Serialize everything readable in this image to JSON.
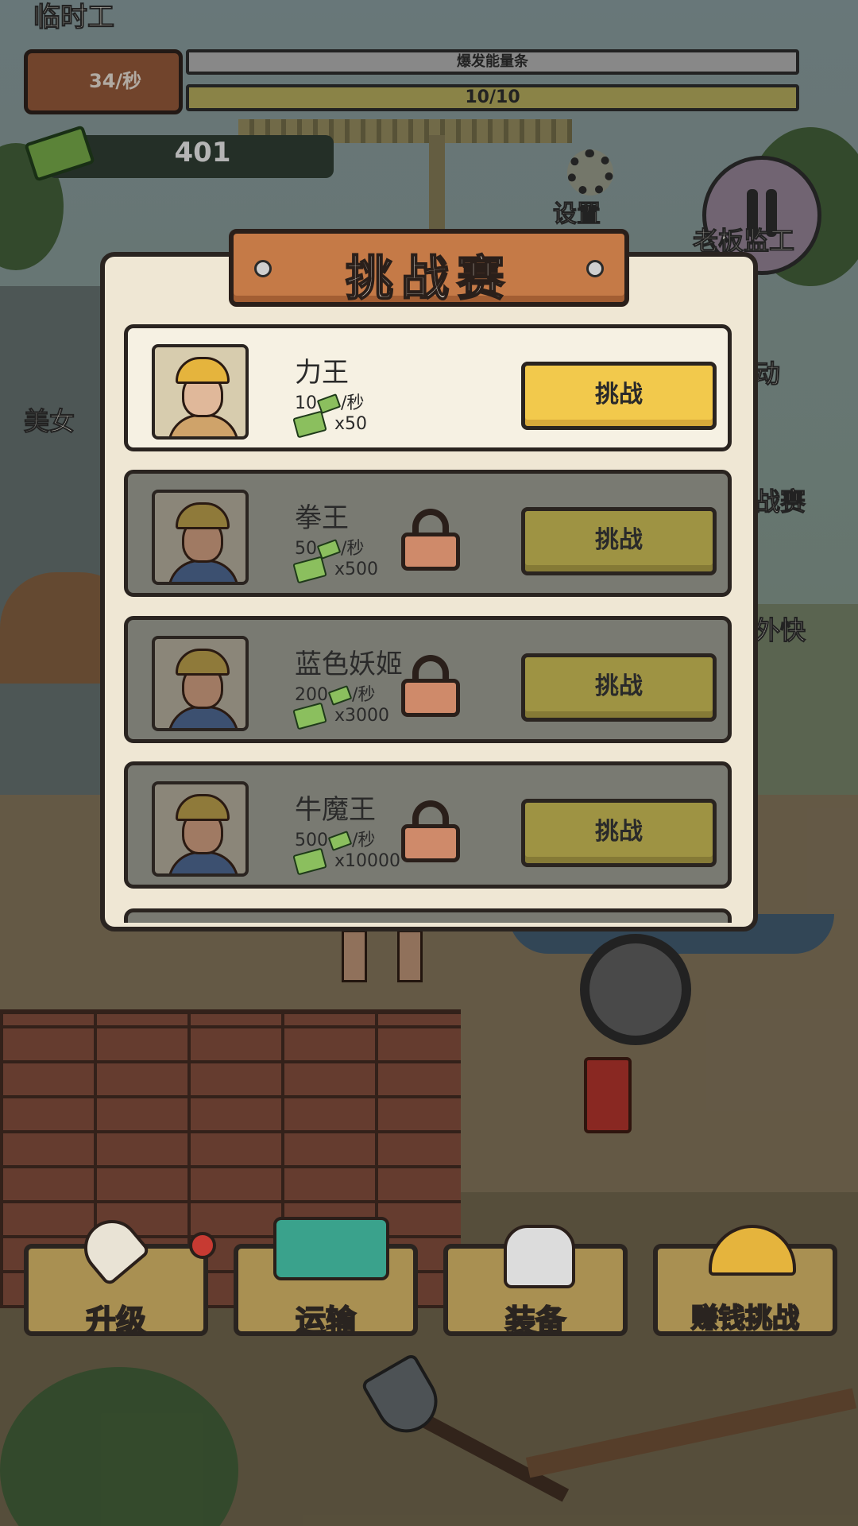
{
  "hud": {
    "job_title": "临时工",
    "rate": "34/秒",
    "burst_label": "爆发能量条",
    "energy_text": "10/10",
    "energy_fraction": 1.0,
    "money": "401"
  },
  "top_right": {
    "settings_label": "设置",
    "boss_label": "老板监工"
  },
  "side": {
    "left_label": "美女",
    "right_labels": [
      "动",
      "战赛",
      "外快"
    ]
  },
  "panel": {
    "title": "挑战赛",
    "challenges": [
      {
        "name": "力王",
        "rate": "10",
        "rate_unit": "/秒",
        "reward": "x50",
        "button": "挑战",
        "locked": false
      },
      {
        "name": "拳王",
        "rate": "50",
        "rate_unit": "/秒",
        "reward": "x500",
        "button": "挑战",
        "locked": true
      },
      {
        "name": "蓝色妖姬",
        "rate": "200",
        "rate_unit": "/秒",
        "reward": "x3000",
        "button": "挑战",
        "locked": true
      },
      {
        "name": "牛魔王",
        "rate": "500",
        "rate_unit": "/秒",
        "reward": "x10000",
        "button": "挑战",
        "locked": true
      }
    ]
  },
  "menu": {
    "upgrade": "升级",
    "transport": "运输",
    "equipment": "装备",
    "earn_challenge": "赚钱挑战"
  },
  "colors": {
    "active_button": "#f2c94c",
    "locked_button": "#9e9343",
    "panel_bg": "#efe7d4",
    "plank": "#c57a47"
  }
}
